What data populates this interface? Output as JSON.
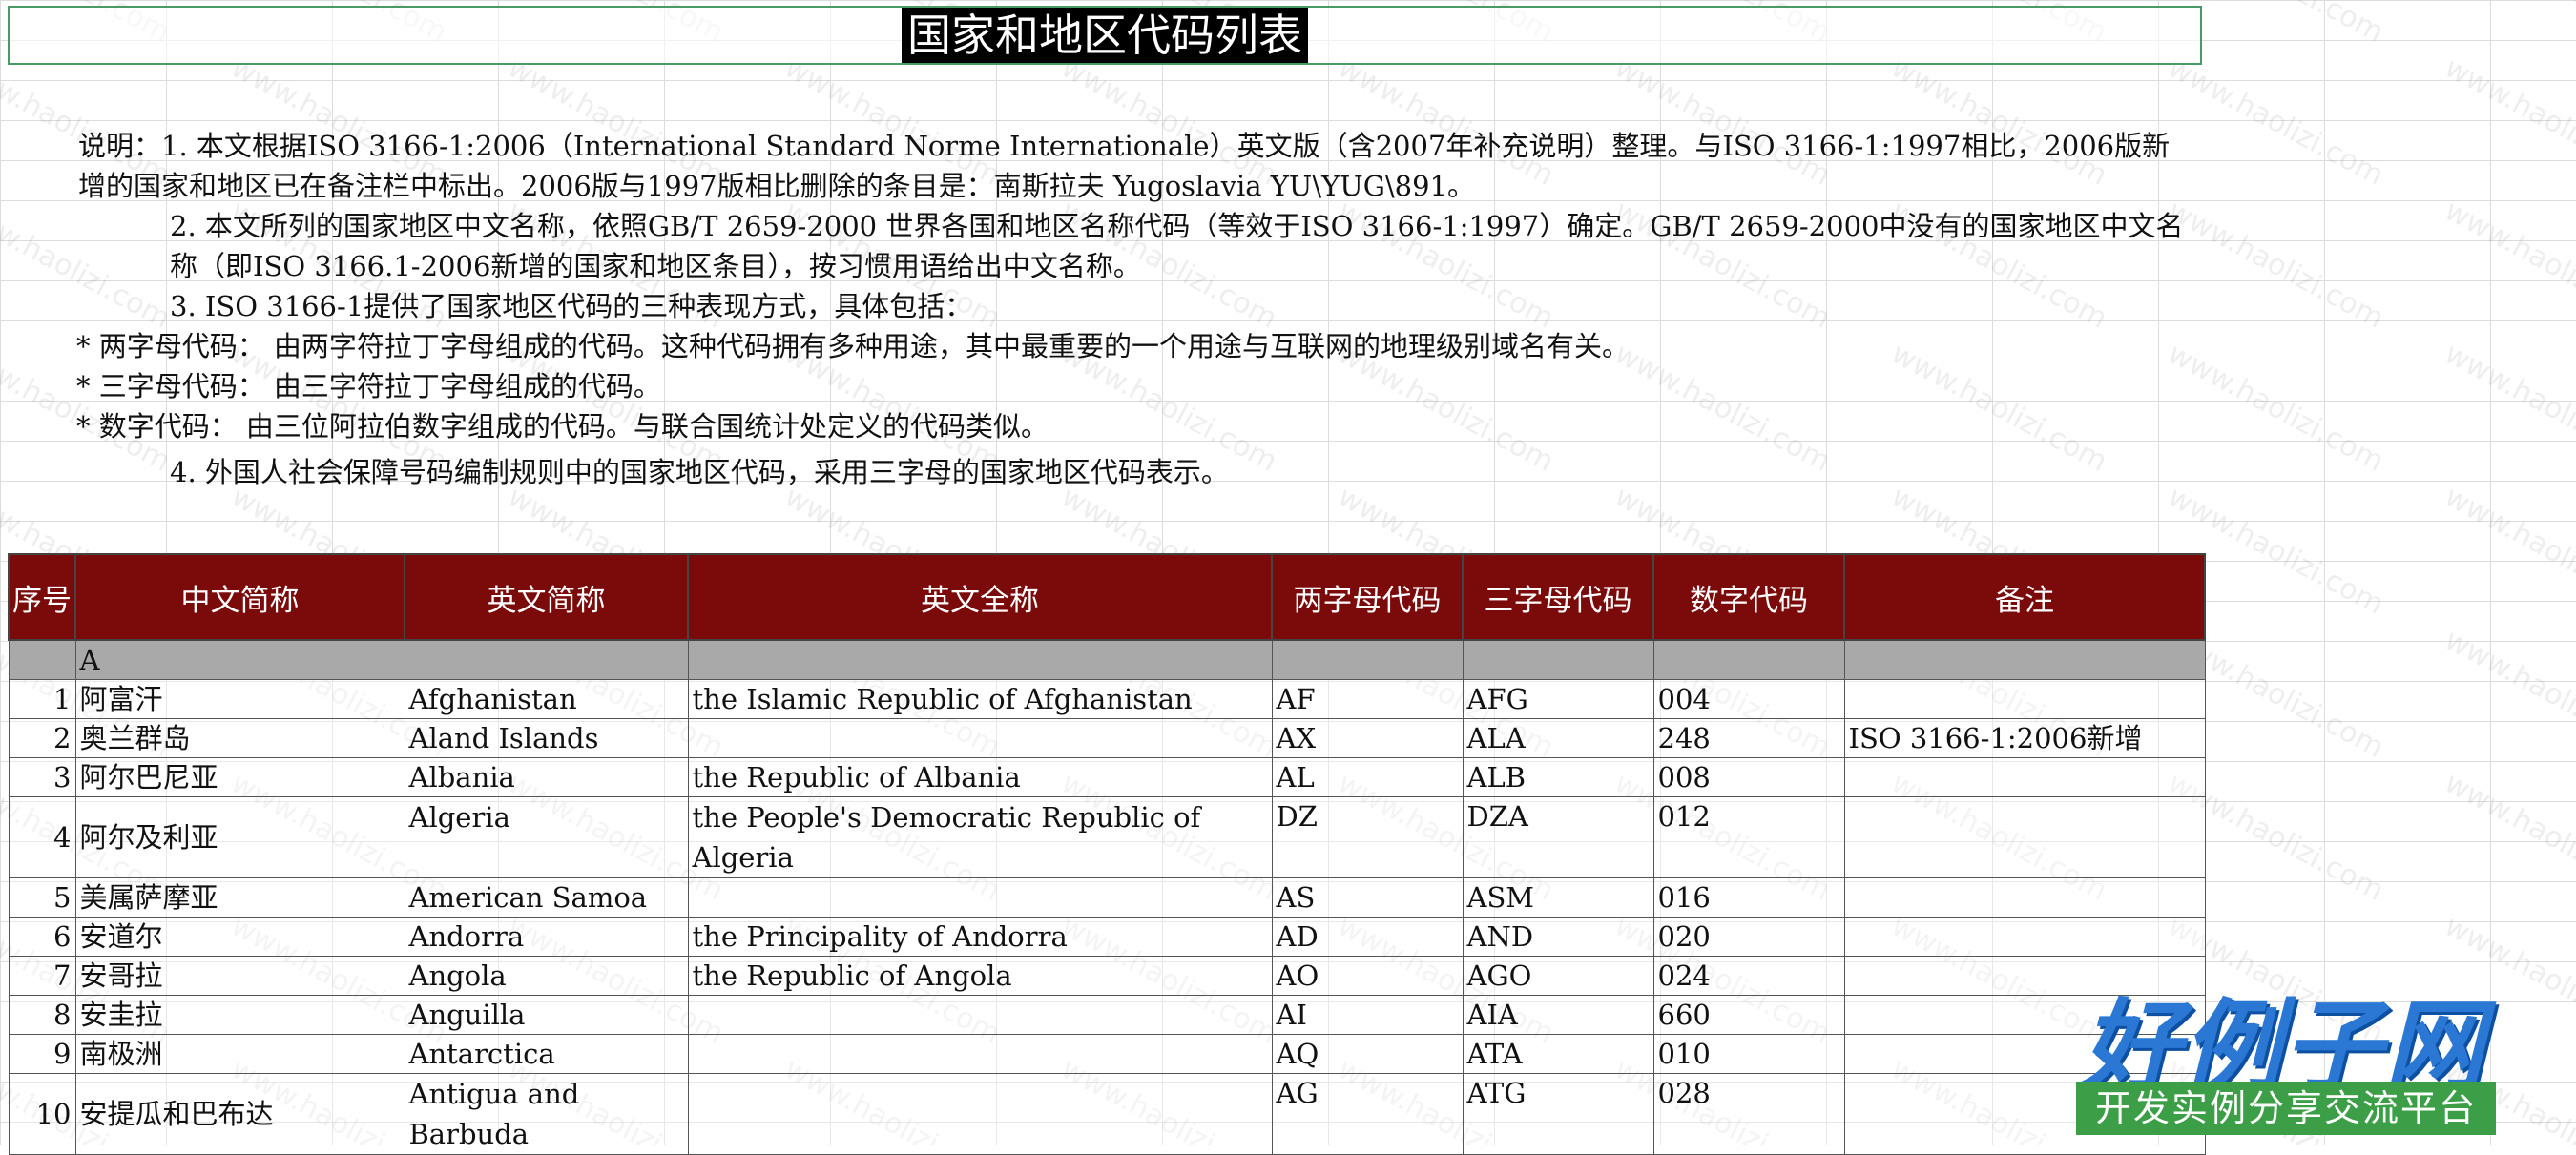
{
  "title": "国家和地区代码列表",
  "notes": [
    "说明：1. 本文根据ISO 3166-1:2006（International Standard Norme Internationale）英文版（含2007年补充说明）整理。与ISO 3166-1:1997相比，2006版新增的国家和地区已在备注栏中标出。2006版与1997版相比删除的条目是：南斯拉夫 Yugoslavia YU\\YUG\\891。",
    "2. 本文所列的国家地区中文名称，依照GB/T 2659-2000 世界各国和地区名称代码（等效于ISO 3166-1:1997）确定。GB/T 2659-2000中没有的国家地区中文名称（即ISO 3166.1-2006新增的国家和地区条目），按习惯用语给出中文名称。",
    "3. ISO 3166-1提供了国家地区代码的三种表现方式，具体包括：",
    "* 两字母代码：  由两字符拉丁字母组成的代码。这种代码拥有多种用途，其中最重要的一个用途与互联网的地理级别域名有关。",
    "* 三字母代码：  由三字符拉丁字母组成的代码。",
    "* 数字代码：  由三位阿拉伯数字组成的代码。与联合国统计处定义的代码类似。",
    "4. 外国人社会保障号码编制规则中的国家地区代码，采用三字母的国家地区代码表示。"
  ],
  "table": {
    "headers": [
      "序号",
      "中文简称",
      "英文简称",
      "英文全称",
      "两字母代码",
      "三字母代码",
      "数字代码",
      "备注"
    ],
    "group": "A",
    "rows": [
      {
        "no": "1",
        "cn": "阿富汗",
        "en": "Afghanistan",
        "full": "the Islamic Republic of Afghanistan",
        "a2": "AF",
        "a3": "AFG",
        "num": "004",
        "note": ""
      },
      {
        "no": "2",
        "cn": "奥兰群岛",
        "en": "Aland Islands",
        "full": "",
        "a2": "AX",
        "a3": "ALA",
        "num": "248",
        "note": "ISO 3166-1:2006新增"
      },
      {
        "no": "3",
        "cn": "阿尔巴尼亚",
        "en": "Albania",
        "full": "the Republic of Albania",
        "a2": "AL",
        "a3": "ALB",
        "num": "008",
        "note": ""
      },
      {
        "no": "4",
        "cn": "阿尔及利亚",
        "en": "Algeria",
        "full": "the People's Democratic Republic of Algeria",
        "a2": "DZ",
        "a3": "DZA",
        "num": "012",
        "note": ""
      },
      {
        "no": "5",
        "cn": "美属萨摩亚",
        "en": "American Samoa",
        "full": "",
        "a2": "AS",
        "a3": "ASM",
        "num": "016",
        "note": ""
      },
      {
        "no": "6",
        "cn": "安道尔",
        "en": "Andorra",
        "full": "the Principality of Andorra",
        "a2": "AD",
        "a3": "AND",
        "num": "020",
        "note": ""
      },
      {
        "no": "7",
        "cn": "安哥拉",
        "en": "Angola",
        "full": "the Republic of Angola",
        "a2": "AO",
        "a3": "AGO",
        "num": "024",
        "note": ""
      },
      {
        "no": "8",
        "cn": "安圭拉",
        "en": "Anguilla",
        "full": "",
        "a2": "AI",
        "a3": "AIA",
        "num": "660",
        "note": ""
      },
      {
        "no": "9",
        "cn": "南极洲",
        "en": "Antarctica",
        "full": "",
        "a2": "AQ",
        "a3": "ATA",
        "num": "010",
        "note": ""
      },
      {
        "no": "10",
        "cn": "安提瓜和巴布达",
        "en": "Antigua and Barbuda",
        "full": "",
        "a2": "AG",
        "a3": "ATG",
        "num": "028",
        "note": ""
      }
    ]
  },
  "watermark": "www.haolizi.com",
  "logo": {
    "main": "好例子网",
    "sub": "开发实例分享交流平台"
  },
  "colors": {
    "header_bg": "#7b0a0a",
    "group_bg": "#a9a9a9",
    "title_border": "#4a9a66",
    "logo_blue": "#2a78d4",
    "logo_green": "#3c9f47"
  }
}
